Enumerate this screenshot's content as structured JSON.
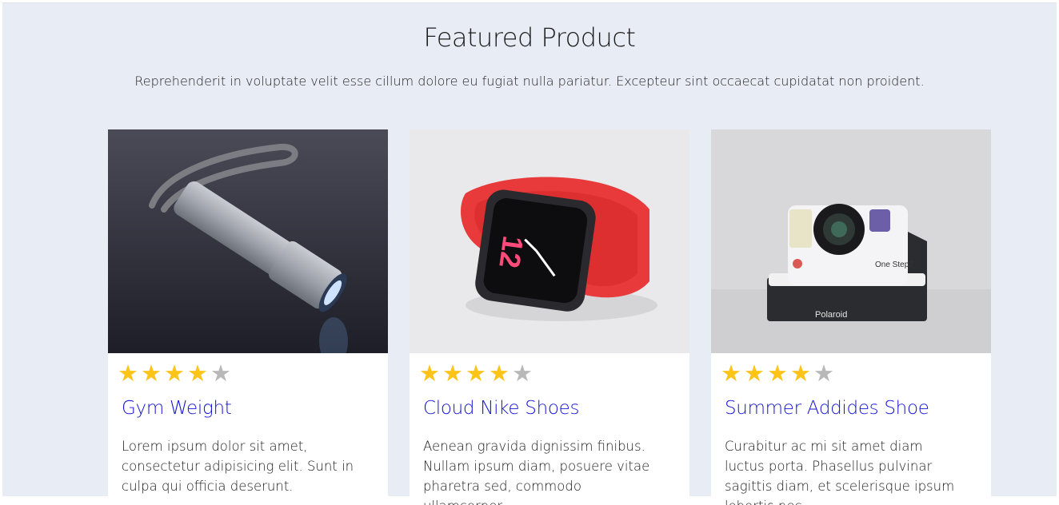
{
  "section": {
    "title": "Featured Product",
    "subtitle": "Reprehenderit in voluptate velit esse cillum dolore eu fugiat nulla pariatur. Excepteur sint occaecat cupidatat non proident."
  },
  "products": [
    {
      "image": "flashlight-image",
      "rating": 4,
      "rating_max": 5,
      "title": "Gym Weight",
      "description": "Lorem ipsum dolor sit amet, consectetur adipisicing elit. Sunt in culpa qui officia deserunt."
    },
    {
      "image": "smartwatch-image",
      "rating": 4,
      "rating_max": 5,
      "title": "Cloud Nike Shoes",
      "description": "Aenean gravida dignissim finibus. Nullam ipsum diam, posuere vitae pharetra sed, commodo ullamcorper"
    },
    {
      "image": "instant-camera-image",
      "rating": 4,
      "rating_max": 5,
      "title": "Summer Addides Shoe",
      "description": "Curabitur ac mi sit amet diam luctus porta. Phasellus pulvinar sagittis diam, et scelerisque ipsum lobortis nec."
    }
  ],
  "colors": {
    "background": "#e8edf5",
    "link": "#1515d6",
    "star_filled": "#fcc419",
    "star_empty": "#b8b8b8"
  }
}
